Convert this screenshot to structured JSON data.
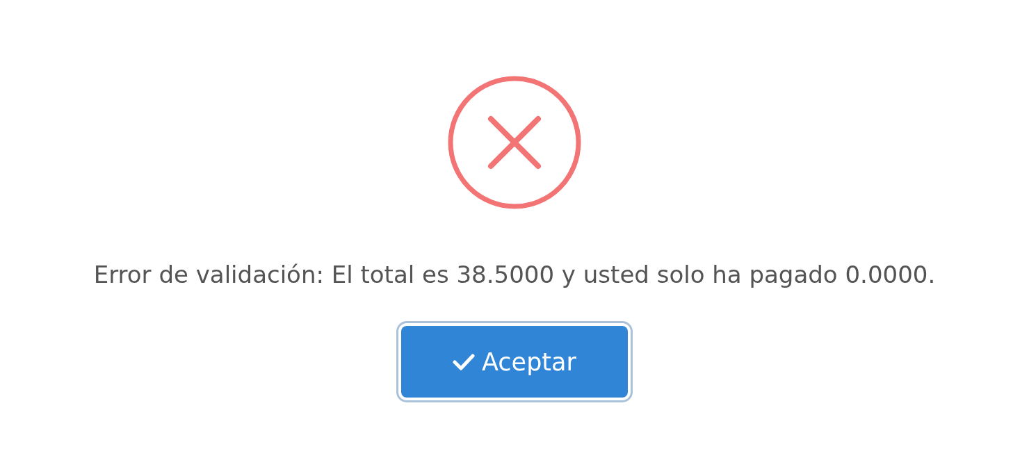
{
  "dialog": {
    "icon": {
      "kind": "error"
    },
    "message": "Error de validación: El total es 38.5000 y usted solo ha pagado 0.0000.",
    "buttons": [
      {
        "label": "Aceptar",
        "focused": true
      }
    ]
  }
}
